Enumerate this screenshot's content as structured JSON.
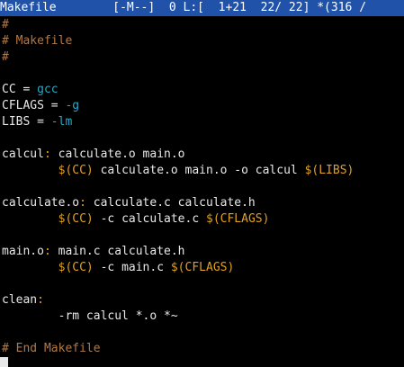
{
  "status_bar": {
    "filename": "Makefile",
    "mode": "[-M--]",
    "info": "0 L:[  1+21  22/ 22] *(316 /"
  },
  "editor": {
    "lines": [
      {
        "segments": [
          {
            "text": "#",
            "style": "comment"
          }
        ]
      },
      {
        "segments": [
          {
            "text": "# Makefile",
            "style": "comment"
          }
        ]
      },
      {
        "segments": [
          {
            "text": "#",
            "style": "comment"
          }
        ]
      },
      {
        "segments": [
          {
            "text": "",
            "style": "plain"
          }
        ]
      },
      {
        "segments": [
          {
            "text": "CC = ",
            "style": "plain"
          },
          {
            "text": "gcc",
            "style": "value"
          }
        ]
      },
      {
        "segments": [
          {
            "text": "CFLAGS = ",
            "style": "plain"
          },
          {
            "text": "-g",
            "style": "value"
          }
        ]
      },
      {
        "segments": [
          {
            "text": "LIBS = ",
            "style": "plain"
          },
          {
            "text": "-lm",
            "style": "value"
          }
        ]
      },
      {
        "segments": [
          {
            "text": "",
            "style": "plain"
          }
        ]
      },
      {
        "segments": [
          {
            "text": "calcul",
            "style": "target"
          },
          {
            "text": ":",
            "style": "keyword"
          },
          {
            "text": " calculate.o main.o",
            "style": "plain"
          }
        ]
      },
      {
        "segments": [
          {
            "text": "        ",
            "style": "plain"
          },
          {
            "text": "$(CC)",
            "style": "keyword"
          },
          {
            "text": " calculate.o main.o -o calcul ",
            "style": "plain"
          },
          {
            "text": "$(LIBS)",
            "style": "keyword"
          }
        ]
      },
      {
        "segments": [
          {
            "text": "",
            "style": "plain"
          }
        ]
      },
      {
        "segments": [
          {
            "text": "calculate.o",
            "style": "target"
          },
          {
            "text": ":",
            "style": "keyword"
          },
          {
            "text": " calculate.c calculate.h",
            "style": "plain"
          }
        ]
      },
      {
        "segments": [
          {
            "text": "        ",
            "style": "plain"
          },
          {
            "text": "$(CC)",
            "style": "keyword"
          },
          {
            "text": " -c calculate.c ",
            "style": "plain"
          },
          {
            "text": "$(CFLAGS)",
            "style": "keyword"
          }
        ]
      },
      {
        "segments": [
          {
            "text": "",
            "style": "plain"
          }
        ]
      },
      {
        "segments": [
          {
            "text": "main.o",
            "style": "target"
          },
          {
            "text": ":",
            "style": "keyword"
          },
          {
            "text": " main.c calculate.h",
            "style": "plain"
          }
        ]
      },
      {
        "segments": [
          {
            "text": "        ",
            "style": "plain"
          },
          {
            "text": "$(CC)",
            "style": "keyword"
          },
          {
            "text": " -c main.c ",
            "style": "plain"
          },
          {
            "text": "$(CFLAGS)",
            "style": "keyword"
          }
        ]
      },
      {
        "segments": [
          {
            "text": "",
            "style": "plain"
          }
        ]
      },
      {
        "segments": [
          {
            "text": "clean",
            "style": "target"
          },
          {
            "text": ":",
            "style": "keyword"
          }
        ]
      },
      {
        "segments": [
          {
            "text": "        -rm calcul *.o *~",
            "style": "plain"
          }
        ]
      },
      {
        "segments": [
          {
            "text": "",
            "style": "plain"
          }
        ]
      },
      {
        "segments": [
          {
            "text": "# End Makefile",
            "style": "comment"
          }
        ]
      }
    ]
  },
  "colors": {
    "status_bar_bg": "#1f52a8",
    "comment": "#b07a4a",
    "keyword": "#e0a020",
    "value": "#2aa8c8",
    "text": "#e8e8e8",
    "background": "#000000"
  }
}
